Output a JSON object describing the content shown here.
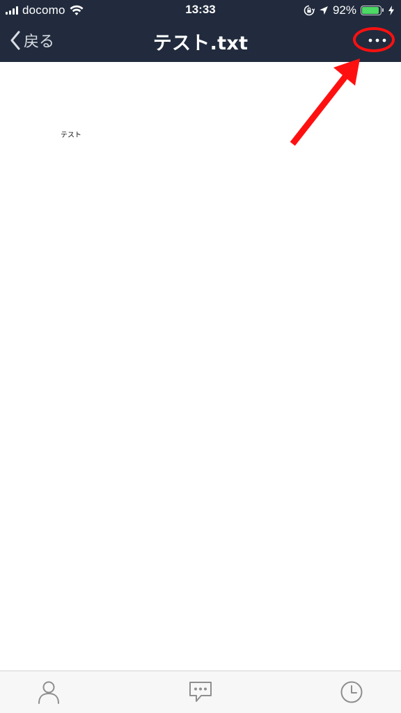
{
  "status_bar": {
    "carrier": "docomo",
    "time": "13:33",
    "battery_percent": "92%",
    "battery_level": 0.92,
    "battery_color": "#4cd964",
    "icons": [
      "signal-icon",
      "wifi-icon",
      "rotation-lock-icon",
      "location-icon",
      "battery-icon",
      "charging-icon"
    ]
  },
  "nav": {
    "back_label": "戻る",
    "title": "テスト.txt",
    "more_icon": "more-dots-icon",
    "background_color": "#212b3d"
  },
  "annotation": {
    "color": "#ff1010",
    "target": "more-button"
  },
  "document": {
    "content": "テスト"
  },
  "tab_bar": {
    "items": [
      {
        "icon": "person-icon"
      },
      {
        "icon": "chat-bubble-icon"
      },
      {
        "icon": "clock-icon"
      }
    ]
  }
}
